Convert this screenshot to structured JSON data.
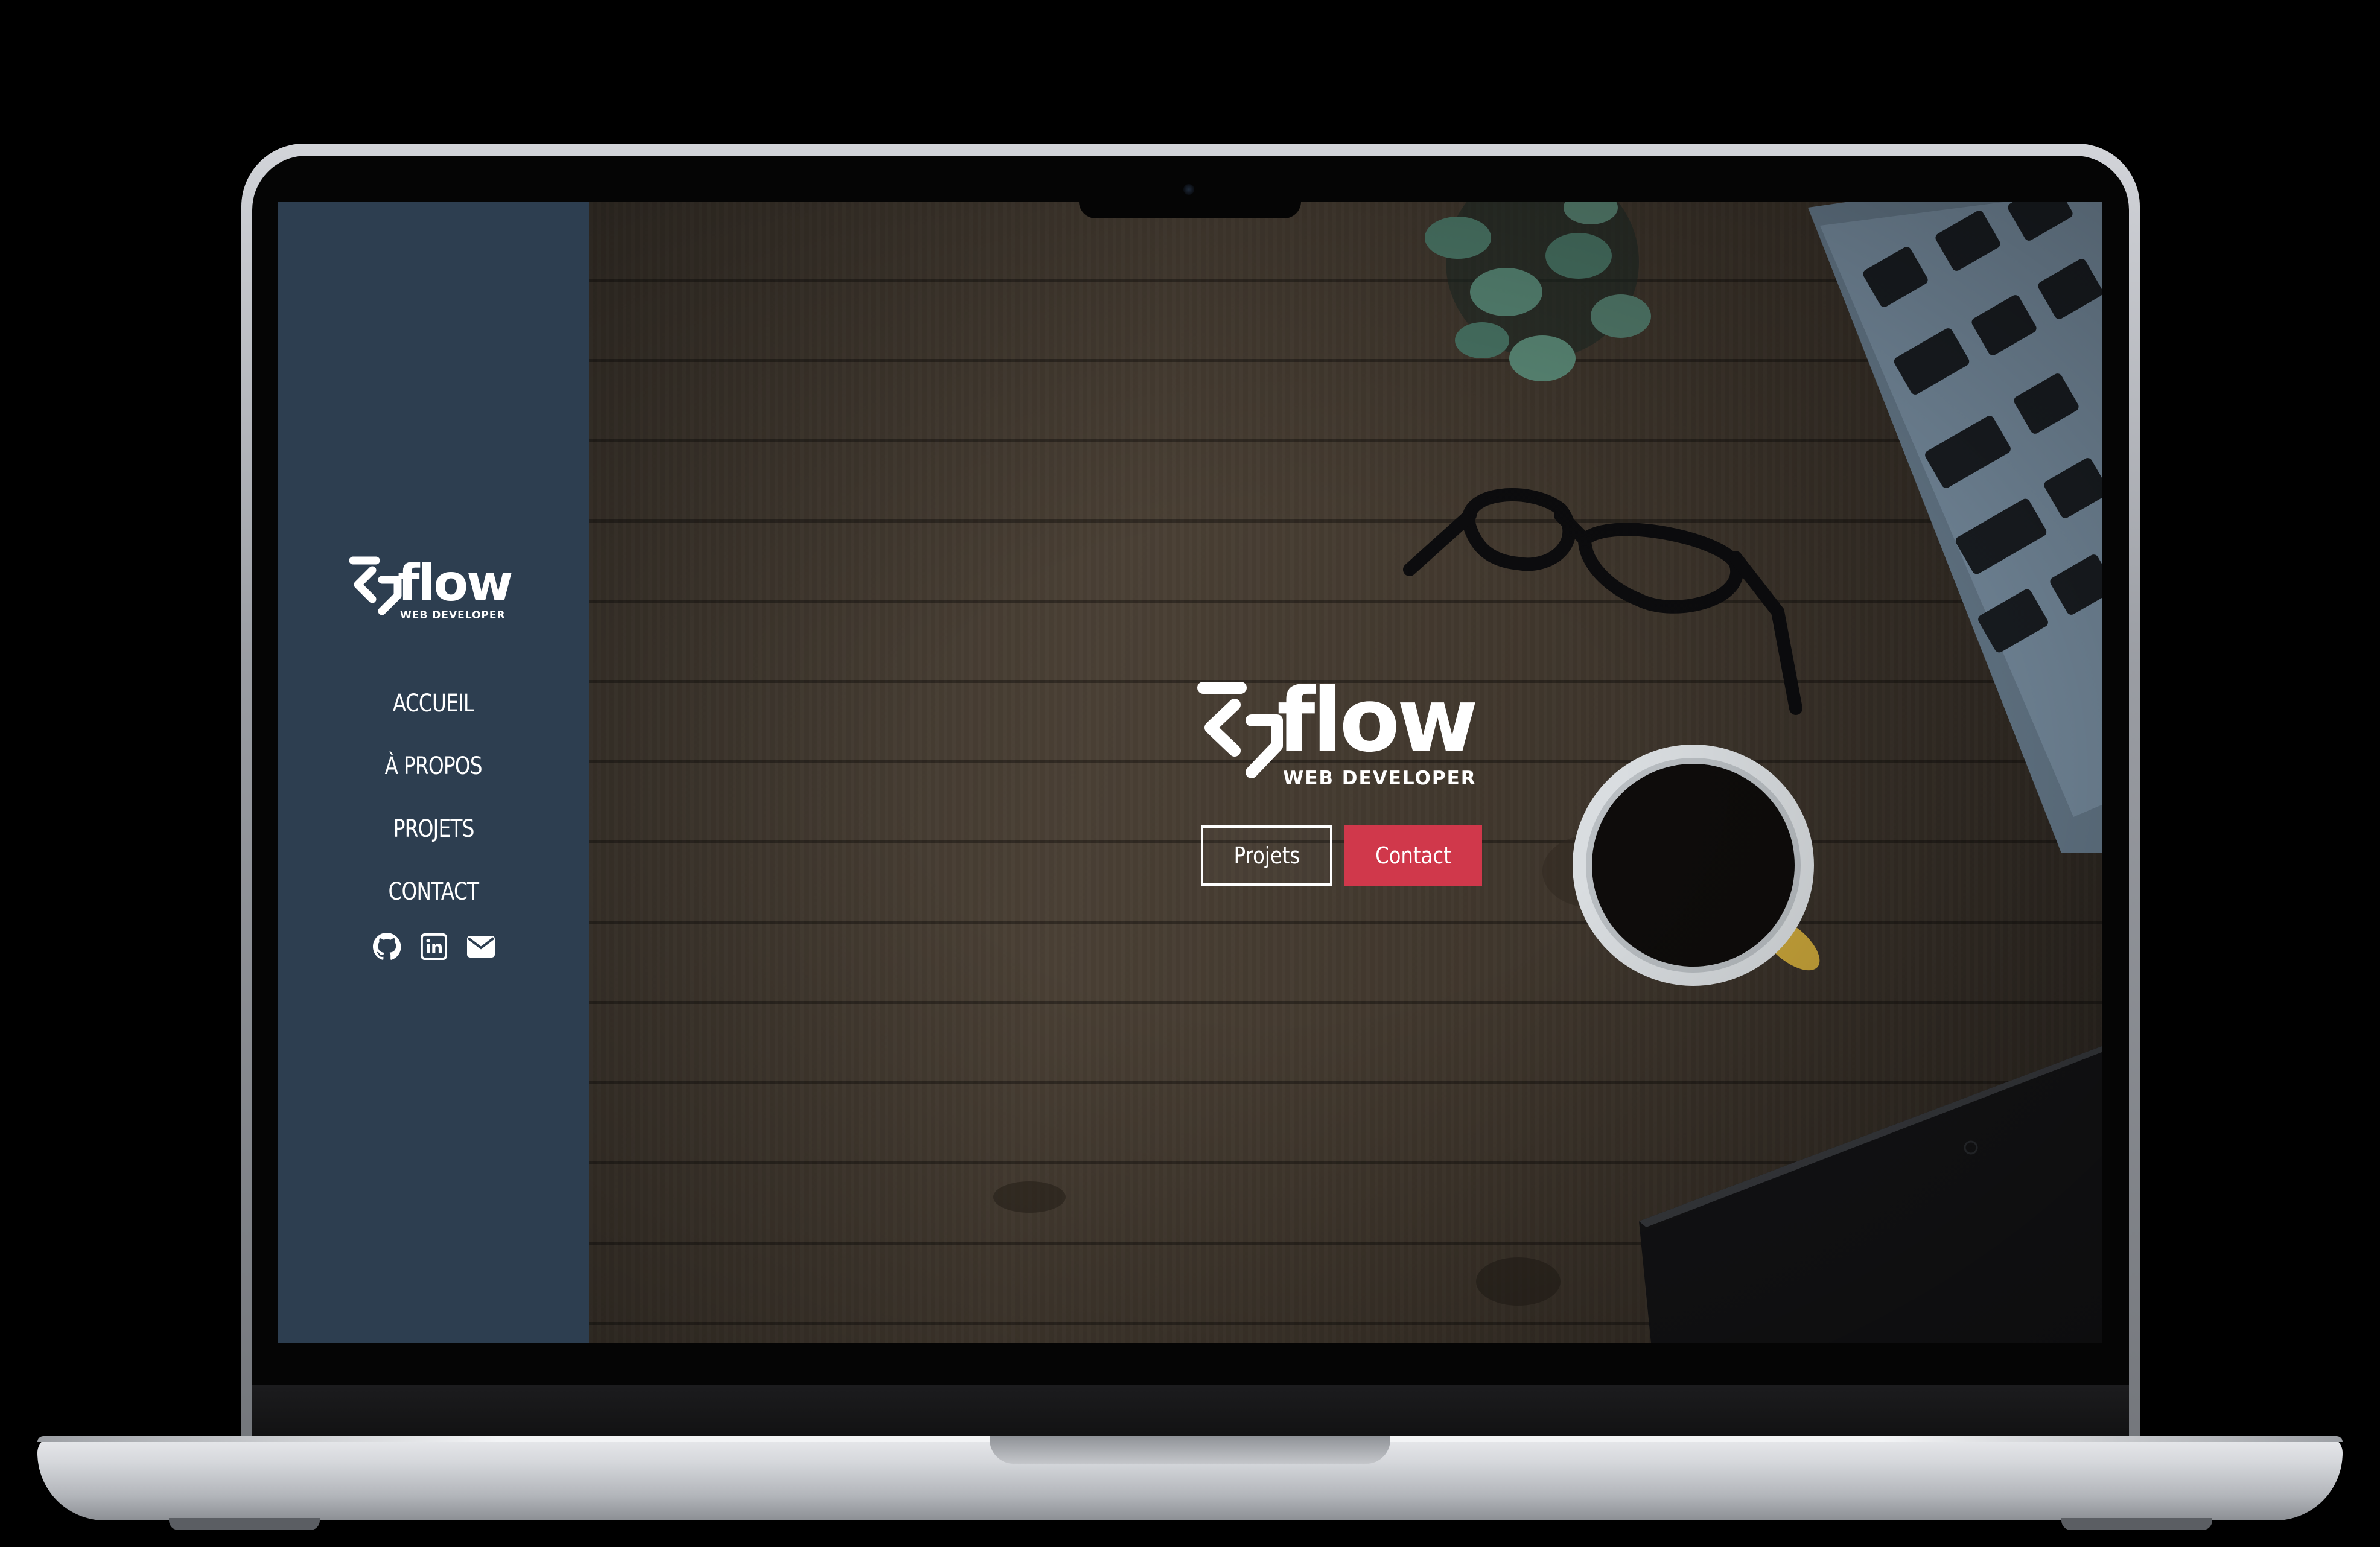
{
  "brand": {
    "name": "flow",
    "tagline": "WEB DEVELOPER"
  },
  "sidebar": {
    "nav": [
      {
        "label": "ACCUEIL"
      },
      {
        "label": "À PROPOS"
      },
      {
        "label": "PROJETS"
      },
      {
        "label": "CONTACT"
      }
    ],
    "socials": [
      {
        "icon": "github-icon"
      },
      {
        "icon": "linkedin-icon"
      },
      {
        "icon": "envelope-icon"
      }
    ]
  },
  "hero": {
    "buttons": {
      "projects_label": "Projets",
      "contact_label": "Contact"
    }
  },
  "colors": {
    "sidebar_bg": "#2d3e50",
    "accent": "#d0384b",
    "text": "#ffffff"
  }
}
